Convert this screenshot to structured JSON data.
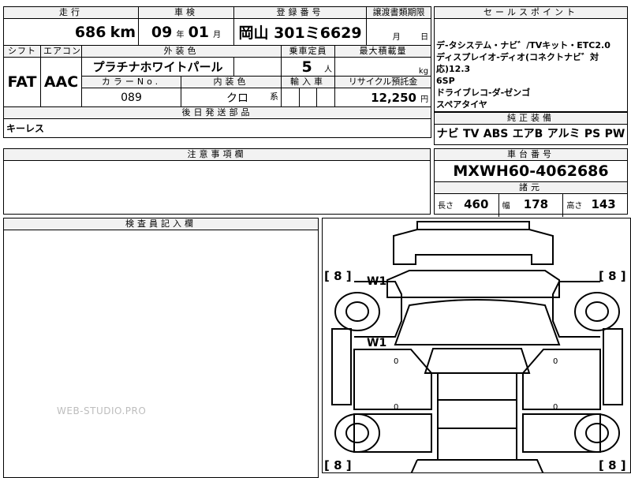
{
  "top_row": {
    "mileage_label": "走行",
    "mileage_value": "686",
    "mileage_unit": "km",
    "inspection_label": "車検",
    "inspection_year": "09",
    "year_unit": "年",
    "inspection_month": "01",
    "month_unit": "月",
    "registration_label": "登録番号",
    "registration_value": "岡山 301ミ6629",
    "transfer_label": "譲渡書類期限",
    "transfer_month_unit": "月",
    "transfer_day_unit": "日"
  },
  "row2": {
    "shift_label": "シフト",
    "shift_value": "FAT",
    "aircon_label": "エアコン",
    "aircon_value": "AAC",
    "exterior_color_label": "外装色",
    "exterior_color_value": "プラチナホワイトパール",
    "capacity_label": "乗車定員",
    "capacity_value": "5",
    "capacity_unit": "人",
    "max_load_label": "最大積載量",
    "max_load_unit": "kg",
    "color_no_label": "カラーNo.",
    "color_no_value": "089",
    "interior_color_label": "内装色",
    "interior_color_value": "クロ",
    "interior_suffix": "系",
    "import_label": "輸入車",
    "recycle_label": "リサイクル預託金",
    "recycle_value": "12,250",
    "recycle_unit": "円"
  },
  "later_parts": {
    "label": "後日発送部品",
    "value": "キーレス"
  },
  "sales_points": {
    "label": "セールスポイント",
    "lines": [
      "デ-タシステム・ナビ゛/TVキット・ETC2.0",
      "ディスプレイオ-ディオ(コネクトナビ゛対応)12.3",
      "6SP",
      "ドライブレコ-ダ-ゼンゴ",
      "スペアタイヤ"
    ]
  },
  "genuine_equipment": {
    "label": "純正装備",
    "items": [
      "ナビ",
      "TV",
      "ABS",
      "エアB",
      "アルミ",
      "PS",
      "PW"
    ]
  },
  "chassis": {
    "label": "車台番号",
    "value": "MXWH60-4062686"
  },
  "dimensions": {
    "label": "諸元",
    "length_label": "長さ",
    "length_value": "460",
    "width_label": "幅",
    "width_value": "178",
    "height_label": "高さ",
    "height_value": "143"
  },
  "notes": {
    "label": "注意事項欄"
  },
  "inspector": {
    "label": "検査員記入欄"
  },
  "watermark": "WEB-STUDIO.PRO",
  "diagram": {
    "tire_marks": [
      "[ 8 ]",
      "[ 8 ]",
      "[ 8 ]",
      "[ 8 ]"
    ],
    "damage_marks": [
      "W1",
      "W1"
    ],
    "zero_marks": [
      "0",
      "0",
      "0",
      "0"
    ]
  }
}
